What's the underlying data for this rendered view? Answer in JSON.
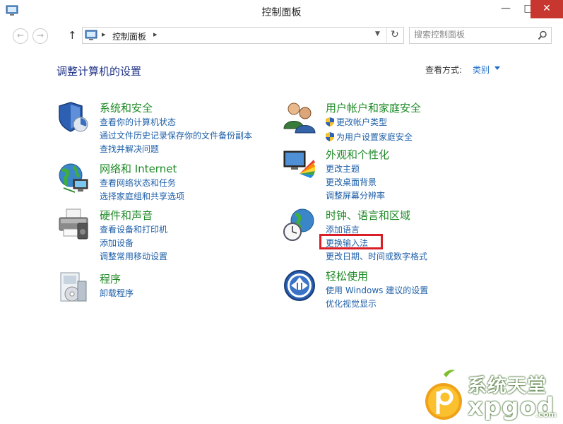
{
  "window": {
    "title": "控制面板",
    "minimize_glyph": "—",
    "maximize_glyph": "□",
    "close_glyph": "✕"
  },
  "address": {
    "back_glyph": "←",
    "forward_glyph": "→",
    "up_glyph": "↑",
    "separator": "▸",
    "path": "控制面板",
    "refresh_glyph": "↻",
    "search_placeholder": "搜索控制面板"
  },
  "heading": "调整计算机的设置",
  "view_by": {
    "label": "查看方式:",
    "value": "类别"
  },
  "categories": {
    "system": {
      "title": "系统和安全",
      "icon": "shield-icon",
      "links": [
        "查看你的计算机状态",
        "通过文件历史记录保存你的文件备份副本",
        "查找并解决问题"
      ]
    },
    "network": {
      "title": "网络和 Internet",
      "icon": "globe-network-icon",
      "links": [
        "查看网络状态和任务",
        "选择家庭组和共享选项"
      ]
    },
    "hardware": {
      "title": "硬件和声音",
      "icon": "printer-icon",
      "links": [
        "查看设备和打印机",
        "添加设备",
        "调整常用移动设置"
      ]
    },
    "programs": {
      "title": "程序",
      "icon": "programs-icon",
      "links": [
        "卸载程序"
      ]
    },
    "users": {
      "title": "用户帐户和家庭安全",
      "icon": "users-icon",
      "links": [
        "更改帐户类型",
        "为用户设置家庭安全"
      ]
    },
    "appearance": {
      "title": "外观和个性化",
      "icon": "monitor-palette-icon",
      "links": [
        "更改主题",
        "更改桌面背景",
        "调整屏幕分辨率"
      ]
    },
    "clock": {
      "title": "时钟、语言和区域",
      "icon": "clock-globe-icon",
      "links": [
        "添加语言",
        "更换输入法",
        "更改日期、时间或数字格式"
      ]
    },
    "ease": {
      "title": "轻松使用",
      "icon": "ease-of-access-icon",
      "links": [
        "使用 Windows 建议的设置",
        "优化视觉显示"
      ]
    }
  },
  "watermark": {
    "top": "系统天堂",
    "bottom": "xpgod",
    "suffix": ".com"
  },
  "colors": {
    "category_title": "#1e8a26",
    "link": "#1e5fa8",
    "heading": "#1e3287",
    "close_button": "#c7372f",
    "highlight": "#d91e26"
  }
}
